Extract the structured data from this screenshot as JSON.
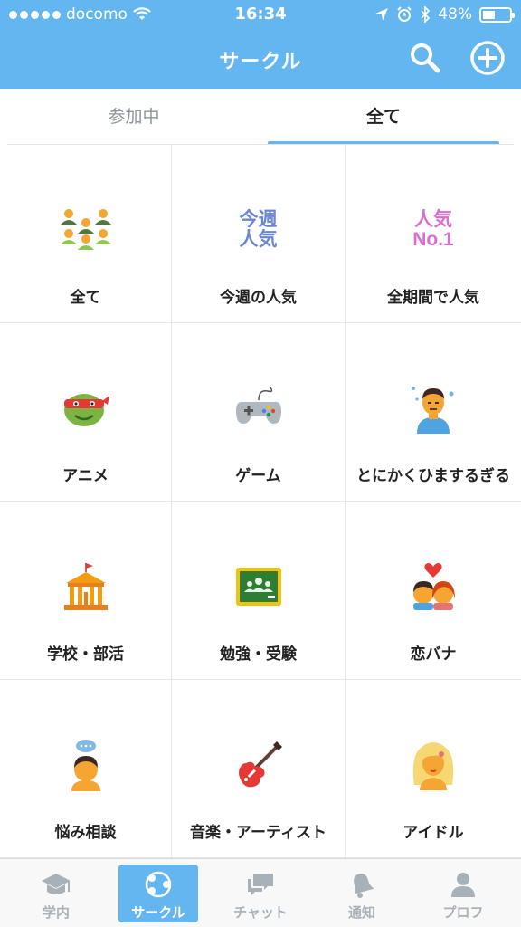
{
  "status_bar": {
    "carrier": "docomo",
    "time": "16:34",
    "battery": "48%",
    "battery_level": 0.48
  },
  "nav": {
    "title": "サークル",
    "search_icon": "search-icon",
    "add_icon": "plus-circle-icon"
  },
  "tabs": [
    {
      "label": "参加中",
      "active": false
    },
    {
      "label": "全て",
      "active": true
    }
  ],
  "categories": [
    {
      "label": "全て",
      "icon": "group-people-icon"
    },
    {
      "label": "今週の人気",
      "icon": "weekly-popular-icon",
      "icon_text": [
        "今週",
        "人気"
      ],
      "icon_color": "#6a86d6"
    },
    {
      "label": "全期間で人気",
      "icon": "all-time-popular-icon",
      "icon_text": [
        "人気",
        "No.1"
      ],
      "icon_color": "#d86fcf"
    },
    {
      "label": "アニメ",
      "icon": "ninja-turtle-icon"
    },
    {
      "label": "ゲーム",
      "icon": "gamepad-icon"
    },
    {
      "label": "とにかくひまするぎる",
      "icon": "bored-person-icon"
    },
    {
      "label": "学校・部活",
      "icon": "school-building-icon"
    },
    {
      "label": "勉強・受験",
      "icon": "chalkboard-icon"
    },
    {
      "label": "恋バナ",
      "icon": "couple-heart-icon"
    },
    {
      "label": "悩み相談",
      "icon": "worried-person-icon"
    },
    {
      "label": "音楽・アーティスト",
      "icon": "electric-guitar-icon"
    },
    {
      "label": "アイドル",
      "icon": "idol-icon"
    }
  ],
  "tabbar": [
    {
      "label": "学内",
      "icon": "graduation-cap-icon",
      "active": false
    },
    {
      "label": "サークル",
      "icon": "share-circle-icon",
      "active": true
    },
    {
      "label": "チャット",
      "icon": "chat-bubbles-icon",
      "active": false
    },
    {
      "label": "通知",
      "icon": "bell-icon",
      "active": false
    },
    {
      "label": "プロフ",
      "icon": "person-icon",
      "active": false
    }
  ],
  "colors": {
    "accent": "#63b6ef",
    "tab_inactive": "#8e959c",
    "tabbar_inactive": "#a9b1b8"
  }
}
